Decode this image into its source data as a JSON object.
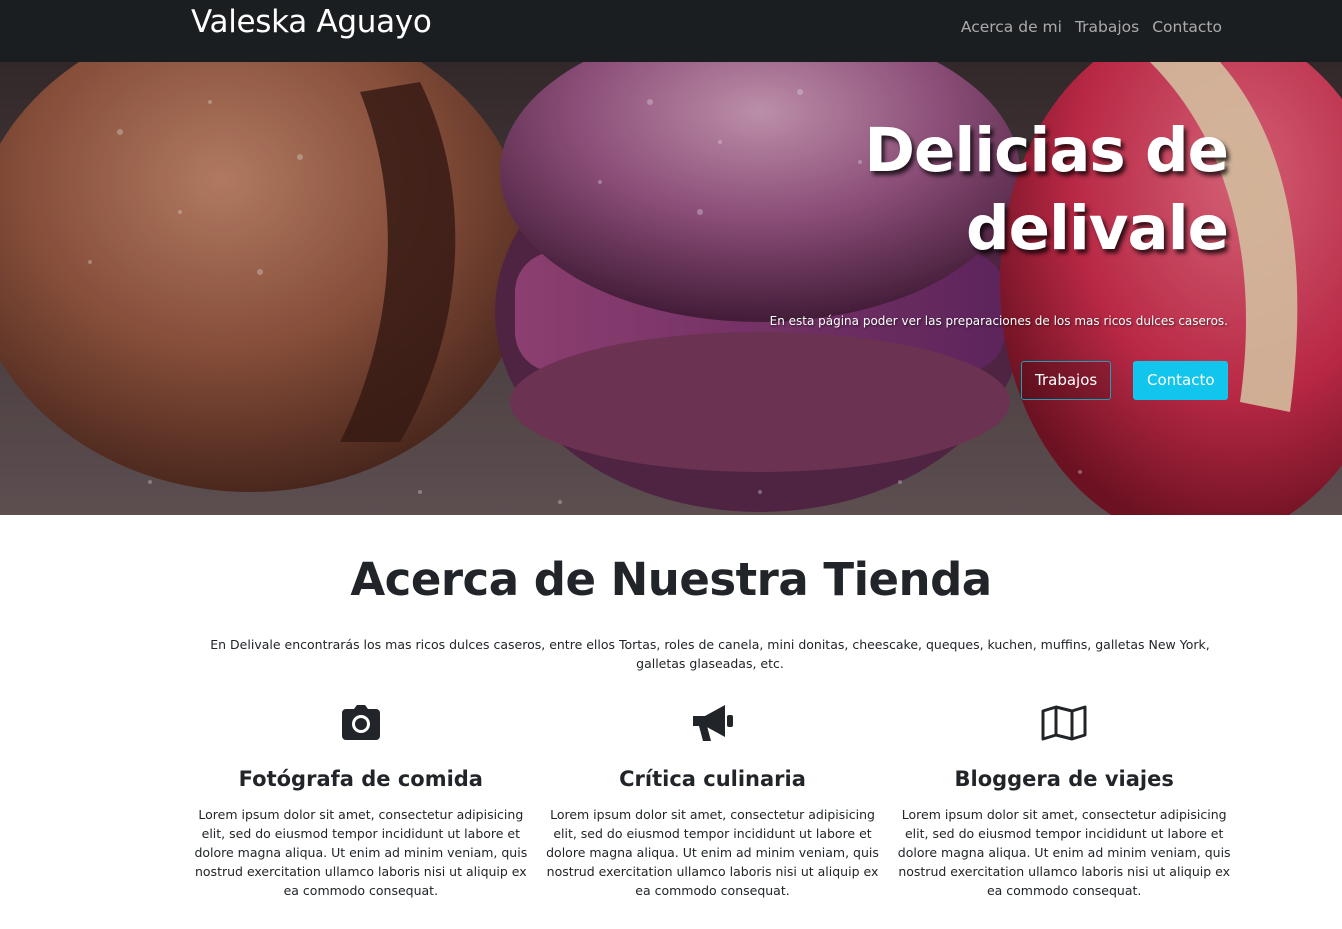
{
  "navbar": {
    "brand": "Valeska Aguayo",
    "links": [
      "Acerca de mi",
      "Trabajos",
      "Contacto"
    ]
  },
  "hero": {
    "title_line1": "Delicias de",
    "title_line2": "delivale",
    "subtitle": "En esta página poder ver las preparaciones de los mas ricos dulces caseros.",
    "button_works": "Trabajos",
    "button_contact": "Contacto"
  },
  "about": {
    "title": "Acerca de Nuestra Tienda",
    "text": "En Delivale encontrarás los mas ricos dulces caseros, entre ellos Tortas, roles de canela, mini donitas, cheescake, queques, kuchen, muffins, galletas New York, galletas glaseadas, etc."
  },
  "features": [
    {
      "icon": "camera-icon",
      "title": "Fotógrafa de comida",
      "text": "Lorem ipsum dolor sit amet, consectetur adipisicing elit, sed do eiusmod tempor incididunt ut labore et dolore magna aliqua. Ut enim ad minim veniam, quis nostrud exercitation ullamco laboris nisi ut aliquip ex ea commodo consequat."
    },
    {
      "icon": "megaphone-icon",
      "title": "Crítica culinaria",
      "text": "Lorem ipsum dolor sit amet, consectetur adipisicing elit, sed do eiusmod tempor incididunt ut labore et dolore magna aliqua. Ut enim ad minim veniam, quis nostrud exercitation ullamco laboris nisi ut aliquip ex ea commodo consequat."
    },
    {
      "icon": "map-icon",
      "title": "Bloggera de viajes",
      "text": "Lorem ipsum dolor sit amet, consectetur adipisicing elit, sed do eiusmod tempor incididunt ut labore et dolore magna aliqua. Ut enim ad minim veniam, quis nostrud exercitation ullamco laboris nisi ut aliquip ex ea commodo consequat."
    }
  ],
  "colors": {
    "navbar_bg": "#1b1e21",
    "accent": "#11c5ec",
    "outline_border": "#17a2b8"
  }
}
